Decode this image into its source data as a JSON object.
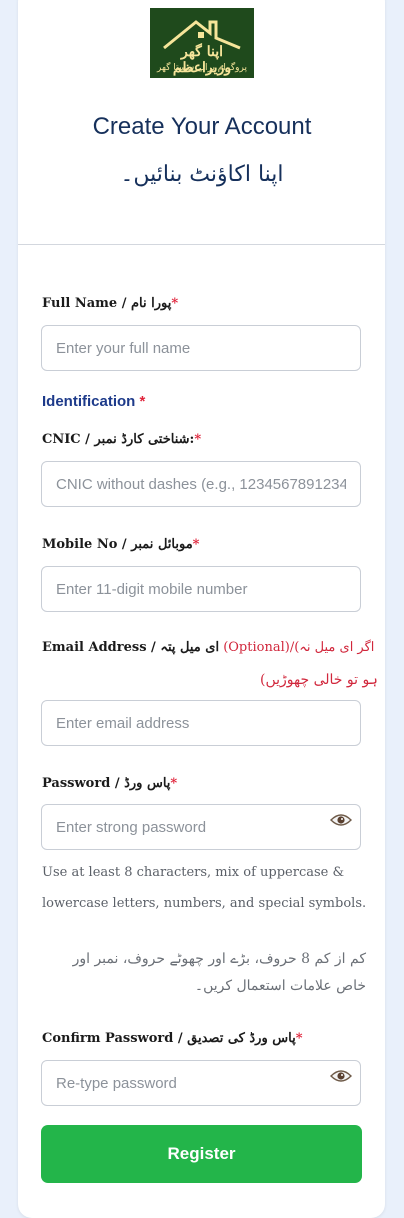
{
  "logo": {
    "line1": "اپنا گھر وزیراعظم",
    "line2": "پروگرام برائے سستا گھر",
    "colors": {
      "background": "#1f4a1c",
      "gold": "#f6e59a"
    }
  },
  "header": {
    "title": "Create Your Account",
    "title_urdu": "اپنا اکاؤنٹ بنائیں۔"
  },
  "fields": {
    "full_name": {
      "label": "Full Name / پورا نام",
      "required_mark": "*",
      "placeholder": "Enter your full name"
    },
    "identification": {
      "label": "Identification",
      "required_mark": "*"
    },
    "cnic": {
      "label": "CNIC / شناختی کارڈ نمبر:",
      "required_mark": "*",
      "placeholder": "CNIC without dashes (e.g., 1234567891234)"
    },
    "mobile": {
      "label": "Mobile No / موبائل نمبر",
      "required_mark": "*",
      "placeholder": "Enter 11-digit mobile number"
    },
    "email": {
      "label_en": "Email Address / ای میل پتہ",
      "label_optional": "(Optional)/(اگر ای میل نہ",
      "label_line2": "ہو تو خالی چھوڑیں)",
      "placeholder": "Enter email address"
    },
    "password": {
      "label": "Password / پاس ورڈ",
      "required_mark": "*",
      "placeholder": "Enter strong password",
      "help_en": "Use at least 8 characters, mix of uppercase & lowercase letters, numbers, and special symbols.",
      "help_ur": "کم از کم 8 حروف، بڑے اور چھوٹے حروف، نمبر اور خاص علامات استعمال کریں۔"
    },
    "confirm_password": {
      "label": "Confirm Password / پاس ورڈ کی تصدیق",
      "required_mark": "*",
      "placeholder": "Re-type password"
    }
  },
  "register_button": {
    "label": "Register",
    "color": "#23b54a"
  },
  "icons": {
    "password_toggle": "eye-icon"
  }
}
